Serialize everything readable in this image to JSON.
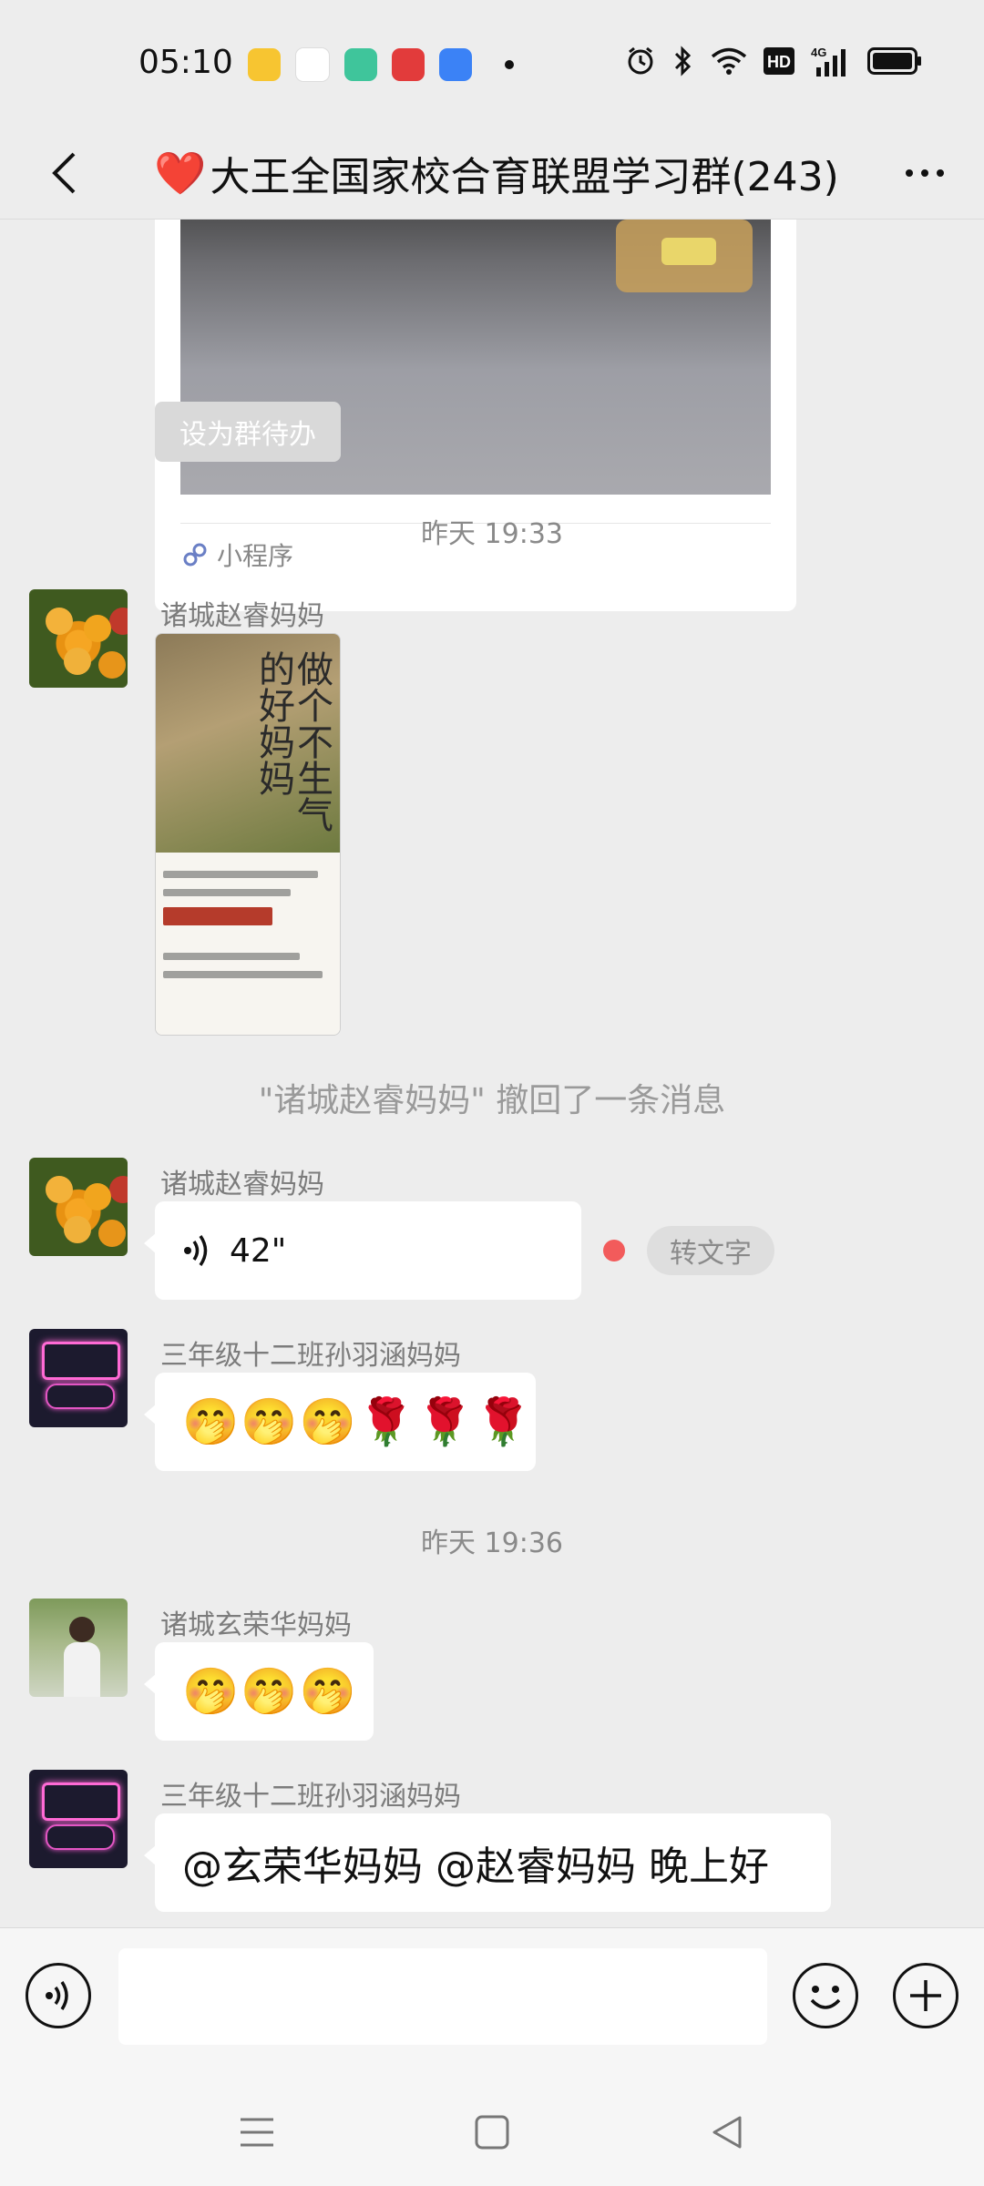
{
  "status_bar": {
    "time": "05:10",
    "app_icons": [
      "notes-icon",
      "browser-icon",
      "store-icon",
      "game-icon",
      "window-icon"
    ],
    "system_icons": [
      "alarm-icon",
      "bluetooth-icon",
      "wifi-icon",
      "hd-icon",
      "signal-4g-icon",
      "battery-icon"
    ],
    "hd_label": "HD",
    "net_label": "4G"
  },
  "header": {
    "title_emoji": "❤️",
    "title": "大王全国家校合育联盟学习群(243)"
  },
  "messages": {
    "card": {
      "footer_label": "小程序"
    },
    "todo_button": "设为群待办",
    "timestamp_1": "昨天 19:33",
    "msg_1": {
      "sender": "诸城赵睿妈妈"
    },
    "book": {
      "title": "做个不生气的好妈妈"
    },
    "recall_notice": "\"诸城赵睿妈妈\" 撤回了一条消息",
    "msg_2": {
      "sender": "诸城赵睿妈妈",
      "voice_duration": "42\"",
      "to_text_label": "转文字"
    },
    "msg_3": {
      "sender": "三年级十二班孙羽涵妈妈",
      "content": "🤭🤭🤭🌹🌹🌹"
    },
    "timestamp_2": "昨天 19:36",
    "msg_4": {
      "sender": "诸城玄荣华妈妈",
      "content": "🤭🤭🤭"
    },
    "msg_5": {
      "sender": "三年级十二班孙羽涵妈妈",
      "content": "@玄荣华妈妈  @赵睿妈妈  晚上好"
    }
  },
  "input_bar": {
    "value": "",
    "placeholder": ""
  },
  "colors": {
    "background": "#ededed",
    "bubble": "#ffffff",
    "unread_dot": "#f25b5b"
  }
}
